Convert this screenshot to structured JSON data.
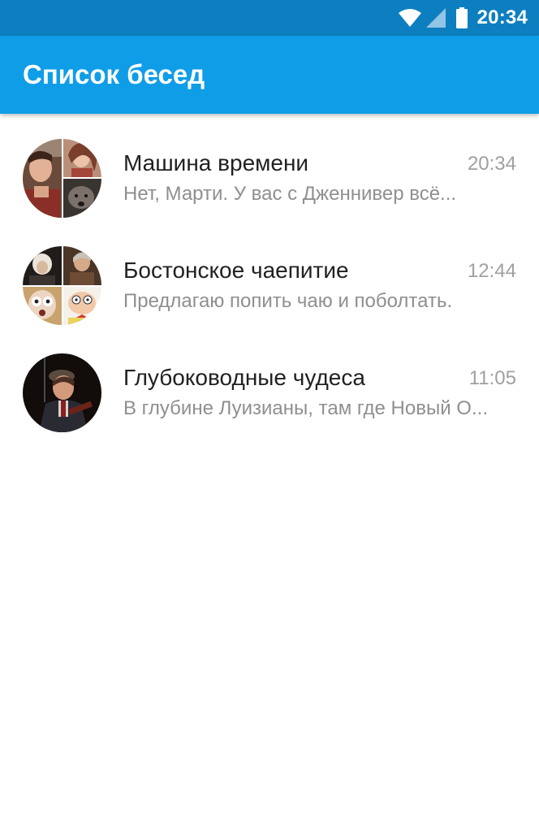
{
  "status_bar": {
    "time": "20:34",
    "icons": [
      "wifi-icon",
      "cell-signal-icon",
      "battery-icon"
    ]
  },
  "app_bar": {
    "title": "Список бесед",
    "color": "#0f9de8"
  },
  "conversations": [
    {
      "title": "Машина времени",
      "time": "20:34",
      "preview": "Нет, Марти. У вас с Дженнивер всё..."
    },
    {
      "title": "Бостонское чаепитие",
      "time": "12:44",
      "preview": "Предлагаю попить чаю и поболтать."
    },
    {
      "title": "Глубоководные чудеса",
      "time": "11:05",
      "preview": "В глубине Луизианы, там где Новый О..."
    }
  ]
}
